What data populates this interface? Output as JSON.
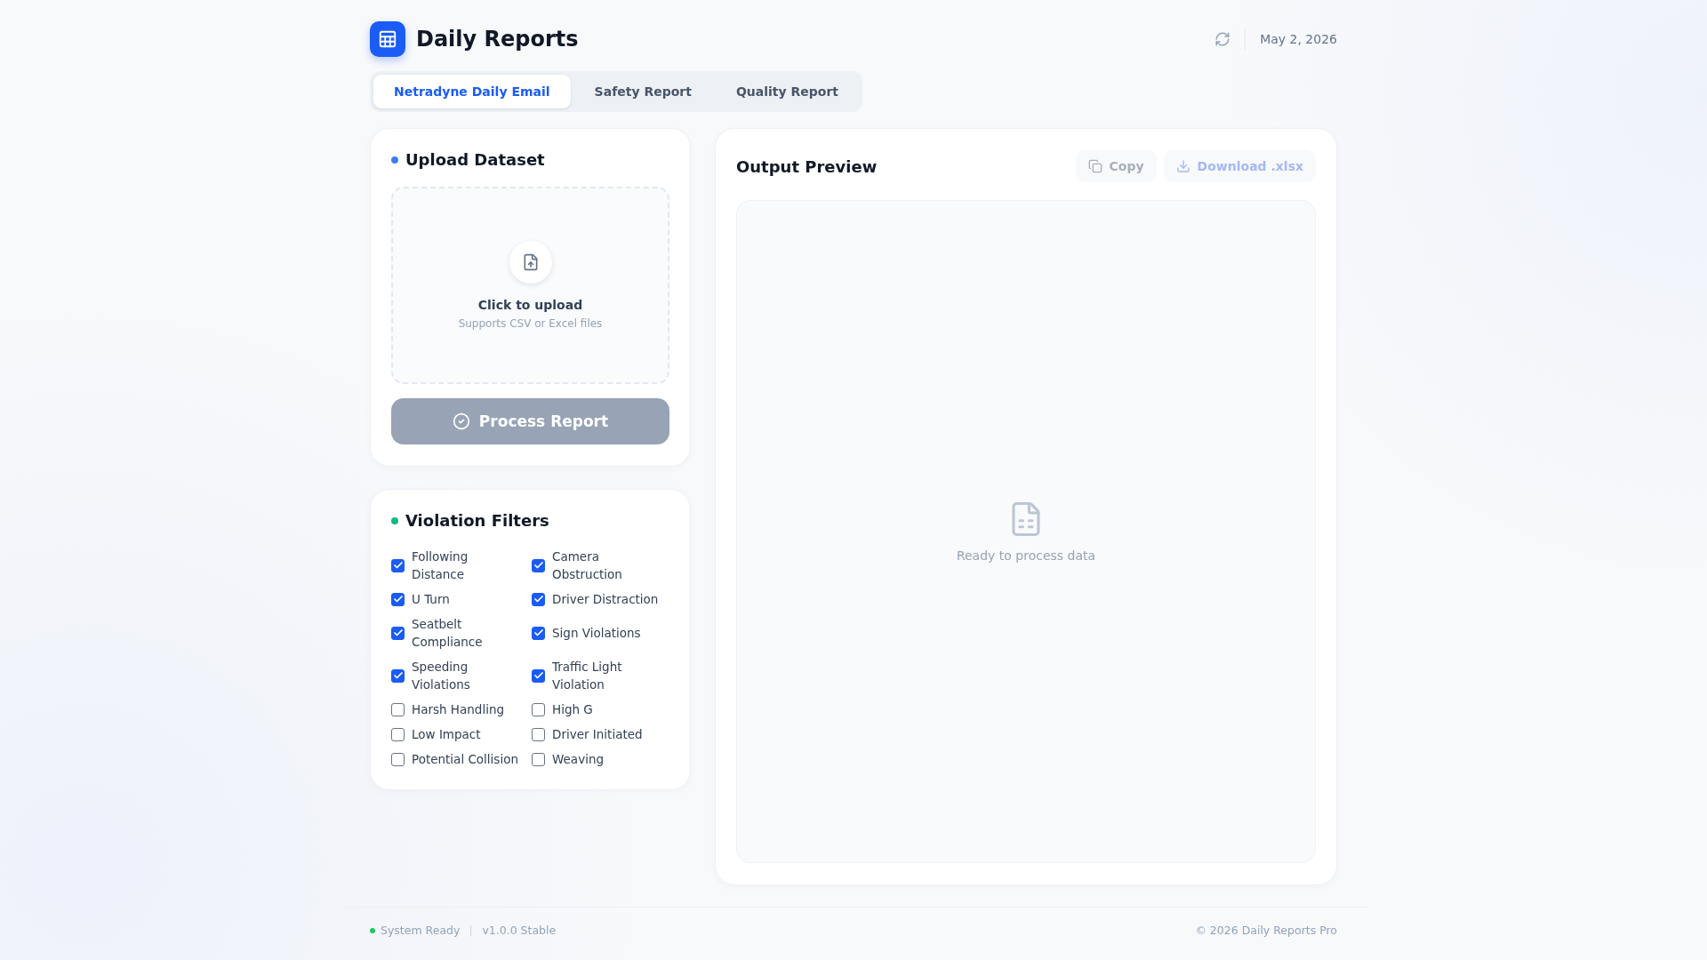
{
  "header": {
    "title": "Daily Reports",
    "date": "May 2, 2026"
  },
  "tabs": [
    {
      "label": "Netradyne Daily Email",
      "selected": true
    },
    {
      "label": "Safety Report",
      "selected": false
    },
    {
      "label": "Quality Report",
      "selected": false
    }
  ],
  "upload_panel": {
    "title": "Upload Dataset",
    "color": "#3b82f6",
    "dropzone_title": "Click to upload",
    "dropzone_hint": "Supports CSV or Excel files",
    "button": {
      "label": "Process Report",
      "disabled": true
    }
  },
  "filters_panel": {
    "title": "Violation Filters",
    "color": "#10b981",
    "filters": [
      {
        "label": "Following Distance",
        "checked": true
      },
      {
        "label": "Camera Obstruction",
        "checked": true
      },
      {
        "label": "U Turn",
        "checked": true
      },
      {
        "label": "Driver Distraction",
        "checked": true
      },
      {
        "label": "Seatbelt Compliance",
        "checked": true
      },
      {
        "label": "Sign Violations",
        "checked": true
      },
      {
        "label": "Speeding Violations",
        "checked": true
      },
      {
        "label": "Traffic Light Violation",
        "checked": true
      },
      {
        "label": "Harsh Handling",
        "checked": false
      },
      {
        "label": "High G",
        "checked": false
      },
      {
        "label": "Low Impact",
        "checked": false
      },
      {
        "label": "Driver Initiated",
        "checked": false
      },
      {
        "label": "Potential Collision",
        "checked": false
      },
      {
        "label": "Weaving",
        "checked": false
      }
    ]
  },
  "output_panel": {
    "title": "Output Preview",
    "actions": [
      {
        "kind": "copy",
        "label": "Copy",
        "disabled": true
      },
      {
        "kind": "download",
        "label": "Download .xlsx",
        "disabled": true
      }
    ],
    "empty_text": "Ready to process data"
  },
  "status_bar": {
    "status": "System Ready",
    "color": "#22c55e",
    "version": "v1.0.0 Stable",
    "copyright": "© 2026 Daily Reports Pro"
  }
}
